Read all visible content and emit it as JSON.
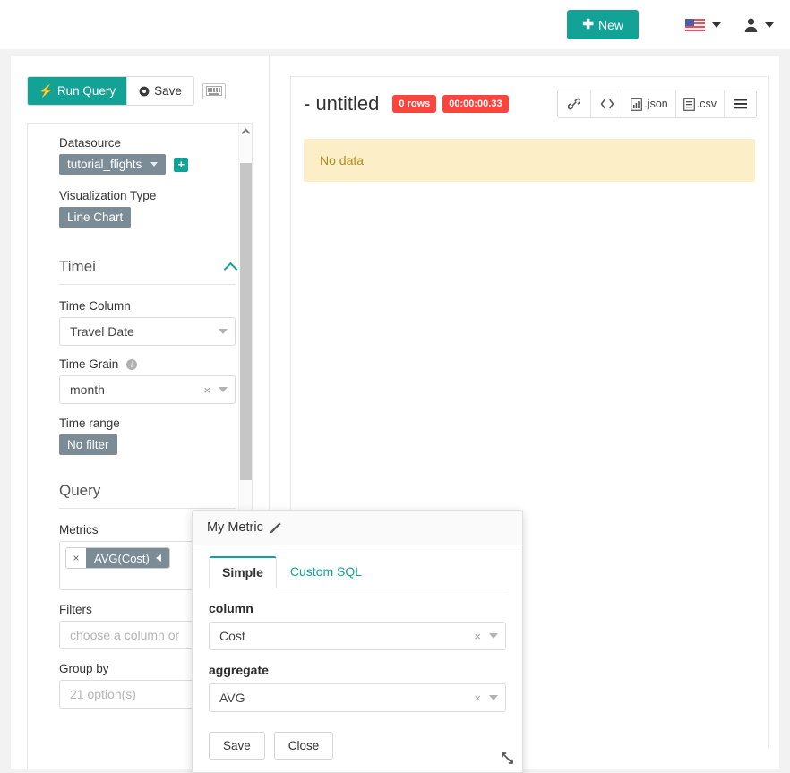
{
  "navbar": {
    "new_button": "New",
    "new_icon": "plus-icon",
    "language_icon": "us-flag-icon",
    "language_caret_icon": "chevron-down-icon",
    "user_icon": "user-icon",
    "user_caret_icon": "chevron-down-icon"
  },
  "toolbar": {
    "run_query": "Run Query",
    "run_icon": "lightning-bolt-icon",
    "save": "Save",
    "save_icon": "gear-icon",
    "keyboard_icon": "keyboard-icon"
  },
  "controls": {
    "datasource_label": "Datasource",
    "datasource_value": "tutorial_flights",
    "datasource_add_icon": "plus-square-icon",
    "viz_type_label": "Visualization Type",
    "viz_type_value": "Line Chart",
    "time_section": "Time",
    "time_info_icon": "info-icon",
    "time_collapse_icon": "chevron-up-icon",
    "time_column_label": "Time Column",
    "time_column_value": "Travel Date",
    "time_grain_label": "Time Grain",
    "time_grain_info_icon": "info-icon",
    "time_grain_value": "month",
    "time_range_label": "Time range",
    "time_range_value": "No filter",
    "query_section": "Query",
    "metrics_label": "Metrics",
    "metric_pill_value": "AVG(Cost)",
    "metric_pill_remove": "×",
    "filters_label": "Filters",
    "filters_placeholder": "choose a column or",
    "groupby_label": "Group by",
    "groupby_placeholder": "21 option(s)",
    "clear_glyph": "×"
  },
  "chart": {
    "title": "- untitled",
    "rows_badge": "0 rows",
    "time_badge": "00:00:00.33",
    "actions": [
      {
        "name": "link-icon",
        "label": ""
      },
      {
        "name": "code-icon",
        "label": ""
      },
      {
        "name": "json-file-icon",
        "label": ".json"
      },
      {
        "name": "csv-file-icon",
        "label": ".csv"
      },
      {
        "name": "hamburger-menu-icon",
        "label": ""
      }
    ],
    "no_data": "No data"
  },
  "popover": {
    "title": "My Metric",
    "edit_icon": "pencil-icon",
    "tab_simple": "Simple",
    "tab_custom_sql": "Custom SQL",
    "column_label": "column",
    "column_value": "Cost",
    "aggregate_label": "aggregate",
    "aggregate_value": "AVG",
    "save_button": "Save",
    "close_button": "Close",
    "resize_icon": "resize-handle-icon",
    "clear_glyph": "×"
  },
  "colors": {
    "accent": "#12a396",
    "danger": "#f9453e",
    "badge_grey": "#7b8c96",
    "warning_bg": "#fcefc7",
    "warning_text": "#b08a24"
  }
}
